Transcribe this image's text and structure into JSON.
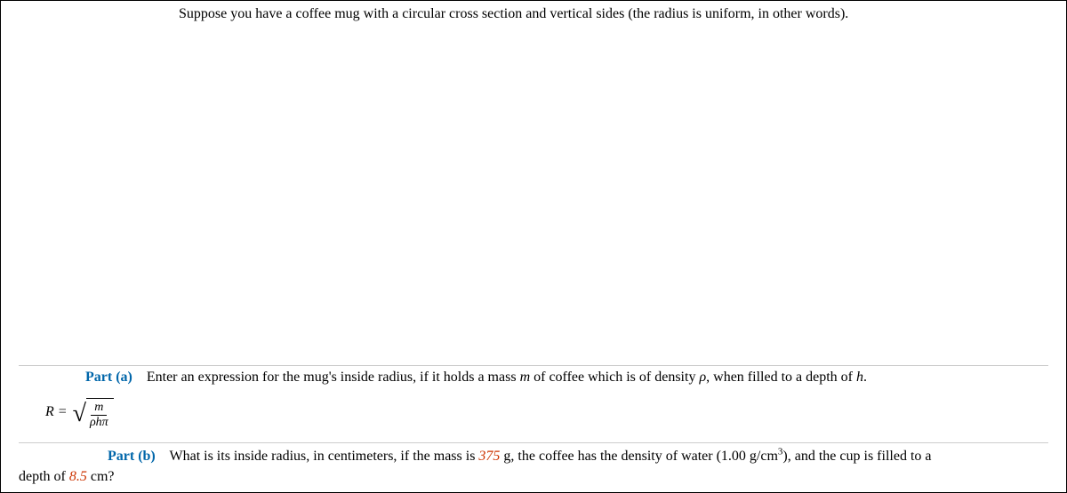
{
  "intro": "Suppose you have a coffee mug with a circular cross section and vertical sides (the radius is uniform, in other words).",
  "part_a": {
    "label": "Part (a)",
    "question_pre": "Enter an expression for the mug's inside radius, if it holds a mass ",
    "mass_var": "m",
    "question_mid": " of coffee which is of density ",
    "rho_var": "ρ",
    "question_mid2": ", when filled to a depth of ",
    "h_var": "h",
    "question_end": ".",
    "formula": {
      "lhs": "R =",
      "numerator": "m",
      "denominator": "ρhπ"
    }
  },
  "part_b": {
    "label": "Part (b)",
    "q1": "What is its inside radius, in centimeters, if the mass is ",
    "mass_value": "375",
    "q2": " g, the coffee has the density of water (1.00 g/cm",
    "cube": "3",
    "q3": "), and the cup is filled to a",
    "depth_pre": "depth of ",
    "depth_value": "8.5",
    "depth_post": " cm?"
  }
}
